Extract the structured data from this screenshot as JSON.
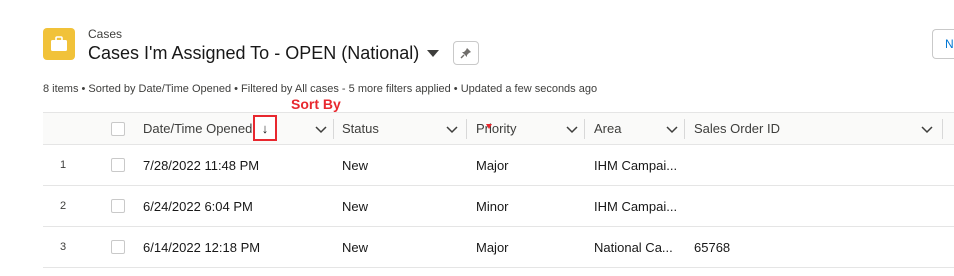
{
  "header": {
    "object_label": "Cases",
    "title": "Cases I'm Assigned To - OPEN (National)",
    "right_button_label": "N"
  },
  "meta": "8 items • Sorted by Date/Time Opened • Filtered by All cases - 5 more filters applied • Updated a few seconds ago",
  "annotation": "Sort By",
  "columns": [
    "Date/Time Opened",
    "Status",
    "Priority",
    "Area",
    "Sales Order ID"
  ],
  "sort_arrow": "↓",
  "rows": [
    {
      "num": "1",
      "date": "7/28/2022 11:48 PM",
      "status": "New",
      "priority": "Major",
      "area": "IHM Campai...",
      "sales_order": ""
    },
    {
      "num": "2",
      "date": "6/24/2022 6:04 PM",
      "status": "New",
      "priority": "Minor",
      "area": "IHM Campai...",
      "sales_order": ""
    },
    {
      "num": "3",
      "date": "6/14/2022 12:18 PM",
      "status": "New",
      "priority": "Major",
      "area": "National Ca...",
      "sales_order": "65768"
    }
  ],
  "colors": {
    "icon_bg": "#f1c239",
    "annotation": "#e8272e",
    "link": "#0176d3"
  },
  "icons": [
    "briefcase-icon",
    "pin-icon",
    "chevron-down-icon",
    "sort-arrow-icon"
  ]
}
